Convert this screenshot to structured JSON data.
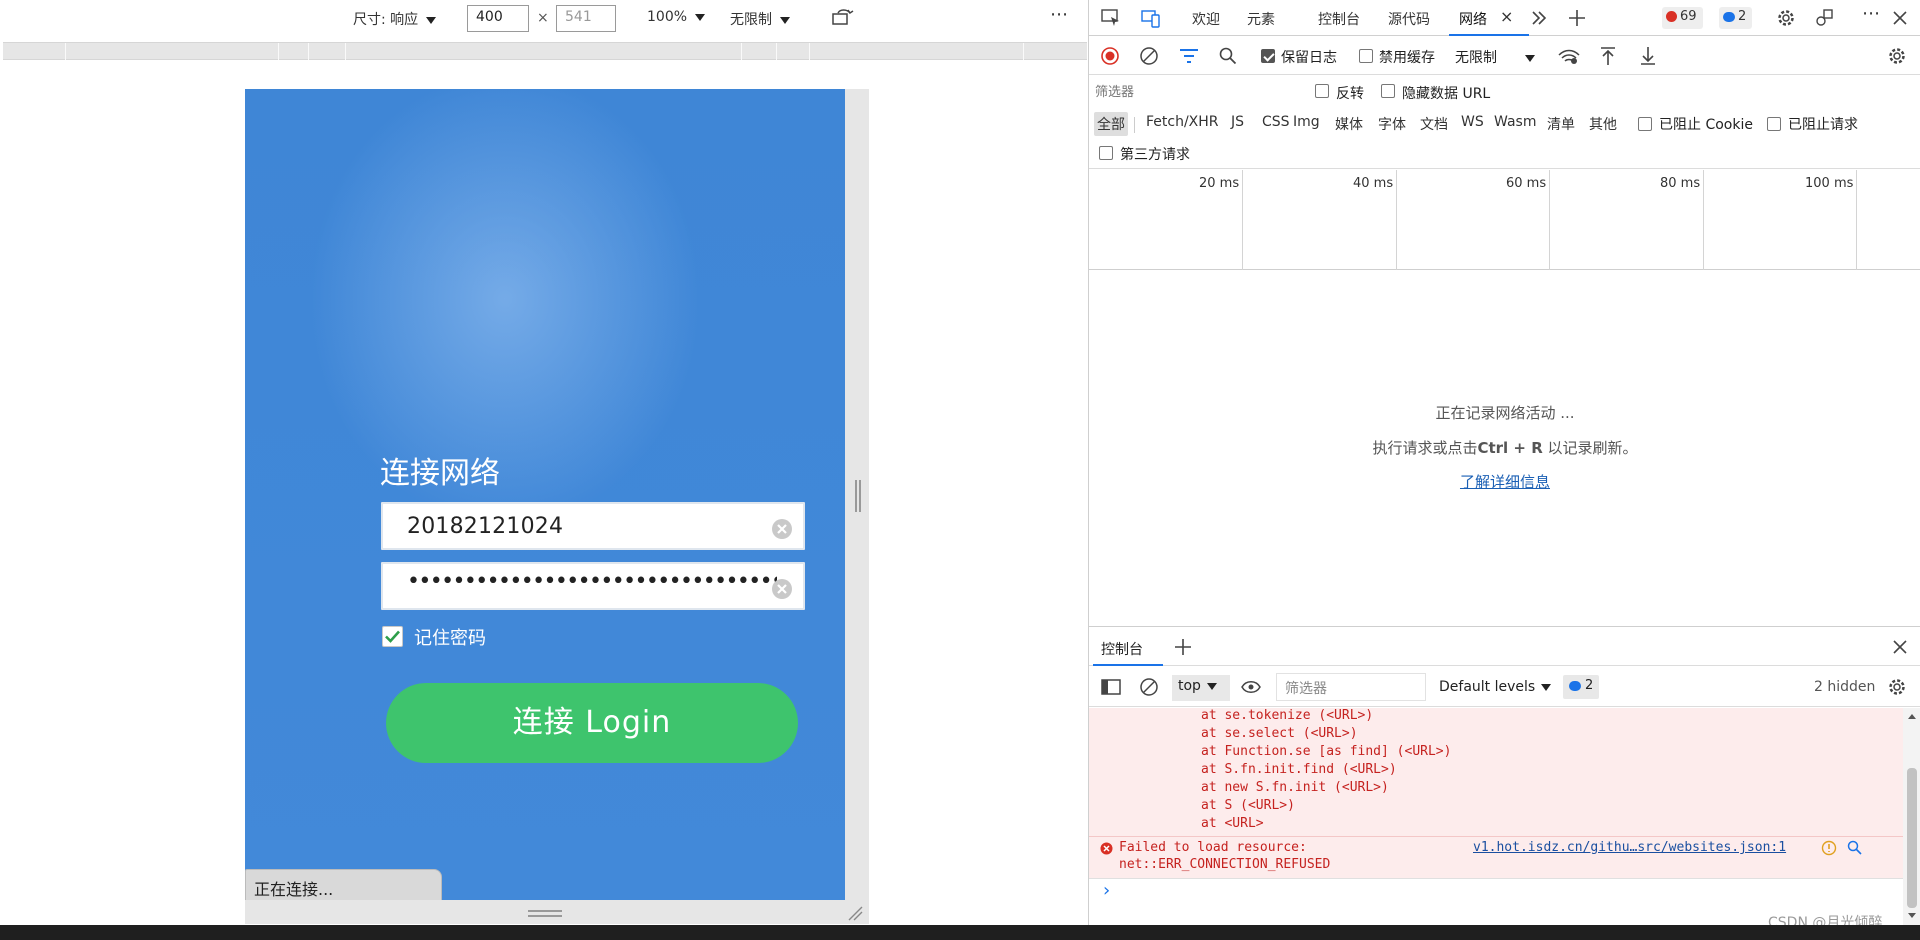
{
  "emulation": {
    "size_label": "尺寸: 响应",
    "width_value": "400",
    "times": "×",
    "height_placeholder": "541",
    "zoom": "100%",
    "throttle": "无限制",
    "more": "⋯"
  },
  "device_page": {
    "title": "连接网络",
    "username": "20182121024",
    "password_mask": "••••••••••••••••••••••••••••••••••••••••••••••••••",
    "remember_label": "记住密码",
    "remember_checked": true,
    "connect_button": "连接 Login",
    "status_text": "正在连接..."
  },
  "devtools": {
    "tabs": [
      "欢迎",
      "元素",
      "控制台",
      "源代码",
      "网络"
    ],
    "active_tab": "网络",
    "tab_close": "×",
    "error_count": "69",
    "message_count": "2",
    "network": {
      "preserve_log": "保留日志",
      "preserve_log_checked": true,
      "disable_cache": "禁用缓存",
      "disable_cache_checked": false,
      "throttling": "无限制",
      "filter_placeholder": "筛选器",
      "invert": "反转",
      "hide_data_urls": "隐藏数据 URL",
      "types": [
        "全部",
        "Fetch/XHR",
        "JS",
        "CSS",
        "Img",
        "媒体",
        "字体",
        "文档",
        "WS",
        "Wasm",
        "清单",
        "其他"
      ],
      "active_type": "全部",
      "blocked_cookies": "已阻止 Cookie",
      "blocked_requests": "已阻止请求",
      "third_party": "第三方请求",
      "timeline_labels": [
        "20 ms",
        "40 ms",
        "60 ms",
        "80 ms",
        "100 ms"
      ],
      "empty_line1": "正在记录网络活动 ...",
      "empty_line2_pre": "执行请求或点击",
      "empty_line2_key": "Ctrl + R",
      "empty_line2_post": " 以记录刷新。",
      "learn_more": "了解详细信息"
    },
    "drawer": {
      "tab": "控制台",
      "context": "top",
      "filter_placeholder": "筛选器",
      "levels": "Default levels",
      "badge_count": "2",
      "hidden": "2 hidden",
      "stack": [
        "at se.tokenize (<URL>)",
        "at se.select (<URL>)",
        "at Function.se [as find] (<URL>)",
        "at S.fn.init.find (<URL>)",
        "at new S.fn.init (<URL>)",
        "at S (<URL>)",
        "at <URL>"
      ],
      "error_line1": "Failed to load resource:",
      "error_line2": "net::ERR_CONNECTION_REFUSED",
      "error_source": "v1.hot.isdz.cn/githu…src/websites.json:1",
      "prompt": "›"
    }
  },
  "watermark": "CSDN @月光倾醉",
  "colors": {
    "device_bg": "#4289d9",
    "connect_green": "#3ec46d",
    "error_bg": "#fdecec",
    "error_text": "#c5221f",
    "link": "#1a5fb4"
  }
}
